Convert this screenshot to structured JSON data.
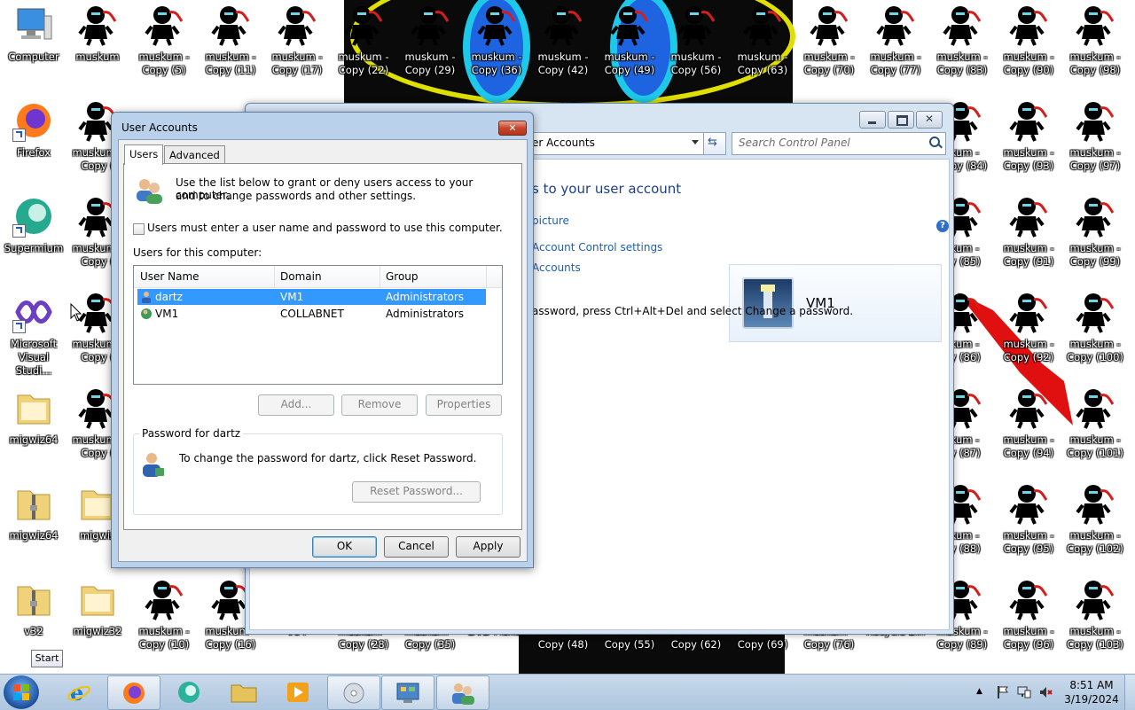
{
  "desktop": {
    "icons": [
      {
        "label": "Computer",
        "kind": "computer"
      },
      {
        "label": "muskum",
        "kind": "ninja"
      },
      {
        "label": "muskum -\nCopy (5)",
        "kind": "ninja"
      },
      {
        "label": "muskum -\nCopy (11)",
        "kind": "ninja"
      },
      {
        "label": "muskum -\nCopy (17)",
        "kind": "ninja"
      },
      {
        "label": "muskum -\nCopy (22)",
        "kind": "ninja"
      },
      {
        "label": "muskum -\nCopy (29)",
        "kind": "ninja"
      },
      {
        "label": "muskum -\nCopy (36)",
        "kind": "ninja"
      },
      {
        "label": "muskum -\nCopy (42)",
        "kind": "ninja"
      },
      {
        "label": "muskum -\nCopy (49)",
        "kind": "ninja"
      },
      {
        "label": "muskum -\nCopy (56)",
        "kind": "ninja"
      },
      {
        "label": "muskum -\nCopy (63)",
        "kind": "ninja"
      },
      {
        "label": "muskum -\nCopy (70)",
        "kind": "ninja"
      },
      {
        "label": "muskum -\nCopy (77)",
        "kind": "ninja"
      },
      {
        "label": "muskum -\nCopy (83)",
        "kind": "ninja"
      },
      {
        "label": "muskum -\nCopy (90)",
        "kind": "ninja"
      },
      {
        "label": "muskum -\nCopy (98)",
        "kind": "ninja"
      },
      {
        "label": "Firefox",
        "kind": "firefox"
      },
      {
        "label": "muskum -\nCopy (",
        "kind": "ninja"
      },
      {
        "label": "skum -\nCopy (84)",
        "kind": "ninja"
      },
      {
        "label": "muskum -\nCopy (93)",
        "kind": "ninja"
      },
      {
        "label": "muskum -\nCopy (97)",
        "kind": "ninja"
      },
      {
        "label": "Supermium",
        "kind": "supermium"
      },
      {
        "label": "muskum -\nCopy (",
        "kind": "ninja"
      },
      {
        "label": "skum -\npy (85)",
        "kind": "ninja"
      },
      {
        "label": "muskum -\nCopy (91)",
        "kind": "ninja"
      },
      {
        "label": "muskum -\nCopy (99)",
        "kind": "ninja"
      },
      {
        "label": "Microsoft\nVisual Studi...",
        "kind": "vs"
      },
      {
        "label": "muskum -\nCopy (",
        "kind": "ninja"
      },
      {
        "label": "skum -\npy (86)",
        "kind": "ninja"
      },
      {
        "label": "muskum -\nCopy (92)",
        "kind": "ninja"
      },
      {
        "label": "muskum -\nCopy (100)",
        "kind": "ninja"
      },
      {
        "label": "migwiz64",
        "kind": "folder"
      },
      {
        "label": "muskum -\nCopy (",
        "kind": "ninja"
      },
      {
        "label": "skum -\npy (87)",
        "kind": "ninja"
      },
      {
        "label": "muskum -\nCopy (94)",
        "kind": "ninja"
      },
      {
        "label": "muskum -\nCopy (101)",
        "kind": "ninja"
      },
      {
        "label": "migwiz64",
        "kind": "zipfolder"
      },
      {
        "label": "migwiz",
        "kind": "folder"
      },
      {
        "label": "skum -\npy (88)",
        "kind": "ninja"
      },
      {
        "label": "muskum -\nCopy (95)",
        "kind": "ninja"
      },
      {
        "label": "muskum -\nCopy (102)",
        "kind": "ninja"
      },
      {
        "label": "v32",
        "kind": "zipfolder"
      },
      {
        "label": "migwiz32",
        "kind": "folder"
      },
      {
        "label": "muskum -\nCopy (10)",
        "kind": "ninja"
      },
      {
        "label": "muskum -\nCopy (16)",
        "kind": "ninja"
      },
      {
        "label": "v64",
        "kind": "none"
      },
      {
        "label": "muskum -\nCopy (28)",
        "kind": "none"
      },
      {
        "label": "muskum -\nCopy (35)",
        "kind": "none"
      },
      {
        "label": "DVD Maker",
        "kind": "none"
      },
      {
        "label": "muskum -\nCopy (48)",
        "kind": "none"
      },
      {
        "label": "muskum -\nCopy (55)",
        "kind": "none"
      },
      {
        "label": "muskum -\nCopy (62)",
        "kind": "none"
      },
      {
        "label": "muskum -\nCopy (69)",
        "kind": "none"
      },
      {
        "label": "muskum -\nCopy (76)",
        "kind": "none"
      },
      {
        "label": "Recycle Bin",
        "kind": "none"
      },
      {
        "label": "muskum -\nCopy (89)",
        "kind": "ninja"
      },
      {
        "label": "muskum -\nCopy (96)",
        "kind": "ninja"
      },
      {
        "label": "muskum -\nCopy (103)",
        "kind": "ninja"
      }
    ]
  },
  "control_panel": {
    "address_text": "er Accounts",
    "search_placeholder": "Search Control Panel",
    "heading": "s to your user account",
    "links": [
      "picture",
      "Account Control settings",
      "Accounts"
    ],
    "user_name": "VM1",
    "note": "assword, press Ctrl+Alt+Del and select Change a password.",
    "help": "?"
  },
  "dialog": {
    "title": "User Accounts",
    "close_glyph": "✕",
    "tabs": [
      "Users",
      "Advanced"
    ],
    "intro_line1": "Use the list below to grant or deny users access to your computer,",
    "intro_line2": "and to change passwords and other settings.",
    "checkbox_label": "Users must enter a user name and password to use this computer.",
    "checkbox_checked": false,
    "list_caption": "Users for this computer:",
    "columns": [
      "User Name",
      "Domain",
      "Group"
    ],
    "rows": [
      {
        "user": "dartz",
        "domain": "VM1",
        "group": "Administrators",
        "selected": true
      },
      {
        "user": "VM1",
        "domain": "COLLABNET",
        "group": "Administrators",
        "selected": false
      }
    ],
    "buttons": {
      "add": "Add...",
      "remove": "Remove",
      "properties": "Properties"
    },
    "password_group_title": "Password for dartz",
    "password_text": "To change the password for dartz, click Reset Password.",
    "reset_button": "Reset Password...",
    "ok": "OK",
    "cancel": "Cancel",
    "apply": "Apply"
  },
  "taskbar": {
    "start_tooltip": "Start",
    "clock_time": "8:51 AM",
    "clock_date": "3/19/2024",
    "tray_expand": "▲"
  }
}
